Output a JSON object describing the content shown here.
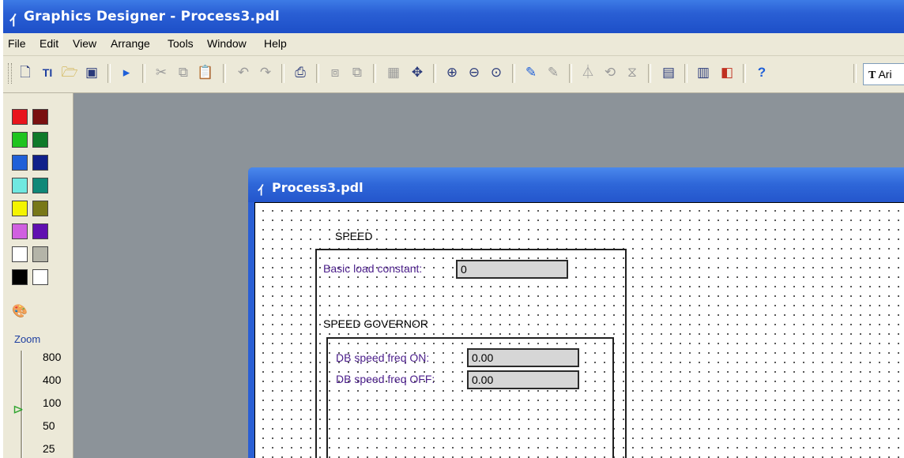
{
  "window": {
    "title": "Graphics Designer - Process3.pdl"
  },
  "menu": [
    "File",
    "Edit",
    "View",
    "Arrange",
    "Tools",
    "Window",
    "Help"
  ],
  "toolbar": {
    "icons": [
      "new-document-icon",
      "new-text-icon",
      "open-icon",
      "save-icon",
      "run-runtime-icon",
      "cut-icon",
      "copy-icon",
      "paste-icon",
      "undo-icon",
      "redo-icon",
      "print-icon",
      "bring-front-icon",
      "send-back-icon",
      "grid-icon",
      "snap-icon",
      "zoom-in-icon",
      "zoom-out-icon",
      "zoom-fit-icon",
      "pipette-icon",
      "pipette-2-icon",
      "flip-icon",
      "rotate-icon",
      "mirror-icon",
      "properties-icon",
      "library-icon",
      "layers-icon",
      "help-icon"
    ],
    "font_box": "Ari"
  },
  "palette": {
    "colors": [
      "#e8141c",
      "#7a1010",
      "#1fc41f",
      "#0f7a2a",
      "#2060d8",
      "#10208a",
      "#70e8e0",
      "#108878",
      "#f4f400",
      "#787818",
      "#d060e0",
      "#6010b0",
      "#ffffff",
      "#b4b4a8",
      "#000000",
      "#ffffff"
    ],
    "zoom_label": "Zoom",
    "zoom_values": [
      "800",
      "400",
      "100",
      "50",
      "25"
    ],
    "zoom_level": "100"
  },
  "document": {
    "title": "Process3.pdl",
    "speed_label": "SPEED",
    "basic_load_label": "Basic load constant:",
    "basic_load_value": "0",
    "governor_label": "SPEED GOVERNOR",
    "db_on_label": "DB speed freq ON:",
    "db_on_value": "0.00",
    "db_off_label": "DB speed freq OFF:",
    "db_off_value": "0.00"
  }
}
